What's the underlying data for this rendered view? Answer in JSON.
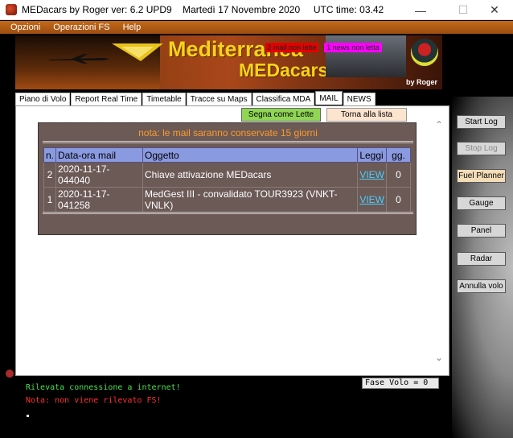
{
  "window": {
    "title": "MEDacars by Roger ver: 6.2 UPD9    Martedì 17 Novembre 2020     UTC time: 03.42",
    "controls": {
      "minimize": "—",
      "maximize": "☐",
      "close": "✕"
    }
  },
  "menu": [
    "Opzioni",
    "Operazioni FS",
    "Help"
  ],
  "banner": {
    "title_line1": "Mediterranea",
    "title_line2": "MEDacars",
    "byline": "by Roger",
    "badge_mail": "2 mail non lette",
    "badge_news": "1 news non letta",
    "colors": {
      "title": "#f5d21a",
      "badge_mail_bg": "#e30000",
      "badge_news_bg": "#ff00ff"
    }
  },
  "tabs": [
    {
      "label": "Piano di Volo",
      "active": false
    },
    {
      "label": "Report Real Time",
      "active": false
    },
    {
      "label": "Timetable",
      "active": false
    },
    {
      "label": "Tracce su Maps",
      "active": false
    },
    {
      "label": "Classifica MDA",
      "active": false
    },
    {
      "label": "MAIL",
      "active": true
    },
    {
      "label": "NEWS",
      "active": false
    }
  ],
  "mail": {
    "btn_mark_read": "Segna come Lette",
    "btn_back": "Torna alla lista",
    "note": "nota: le mail saranno conservate 15 giorni",
    "columns": [
      "n.",
      "Data-ora mail",
      "Oggetto",
      "Leggi",
      "gg."
    ],
    "rows": [
      {
        "n": "2",
        "date": "2020-11-17-044040",
        "subject": "Chiave attivazione MEDacars",
        "read": "VIEW",
        "gg": "0"
      },
      {
        "n": "1",
        "date": "2020-11-17-041258",
        "subject": "MedGest III - convalidato TOUR3923 (VNKT-VNLK)",
        "read": "VIEW",
        "gg": "0"
      }
    ]
  },
  "side_buttons": [
    {
      "label": "Start Log",
      "state": "normal"
    },
    {
      "label": "Stop Log",
      "state": "disabled"
    },
    {
      "label": "Fuel Planner",
      "state": "highlight"
    },
    {
      "label": "Gauge",
      "state": "normal"
    },
    {
      "label": "Panel",
      "state": "normal"
    },
    {
      "label": "Radar",
      "state": "normal"
    },
    {
      "label": "Annulla volo",
      "state": "normal"
    }
  ],
  "status": {
    "fase_volo": "Fase Volo = 0",
    "log_internet": "Rilevata connessione a internet!",
    "log_fs": "Nota: non viene rilevato FS!"
  }
}
